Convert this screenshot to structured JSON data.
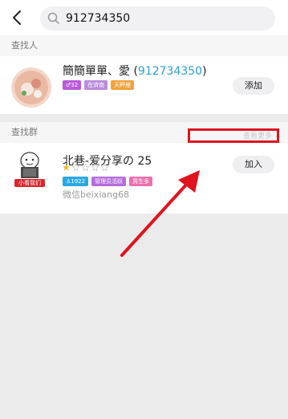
{
  "search": {
    "query": "912734350"
  },
  "person_section": {
    "header": "查找人",
    "result": {
      "name": "簡簡單單、愛",
      "name_open": " (",
      "id": "912734350",
      "name_close": ")",
      "tags": [
        {
          "label": "♂32",
          "color": "#b85ad9"
        },
        {
          "label": "在濟南",
          "color": "#b98bdc"
        },
        {
          "label": "天秤座",
          "color": "#f2a23d"
        }
      ],
      "button": "添加"
    }
  },
  "group_section": {
    "header": "查找群",
    "view_more": "查看更多",
    "result": {
      "name": "北巷-爱分享の 25",
      "rating": {
        "filled": 1,
        "total": 5
      },
      "tags": [
        {
          "label": "♙1922",
          "color": "#2aa8e4"
        },
        {
          "label": "管理员活跃",
          "color": "#b56cdd"
        },
        {
          "label": "男生多",
          "color": "#ee6fae"
        }
      ],
      "wechat": "微信beixiang68",
      "avatar_caption": "小看我们",
      "button": "加入"
    }
  },
  "icons": {
    "back": "back-arrow-icon",
    "search": "search-icon"
  },
  "colors": {
    "annotation_red": "#e0141e",
    "id_blue": "#2e9fd4"
  }
}
